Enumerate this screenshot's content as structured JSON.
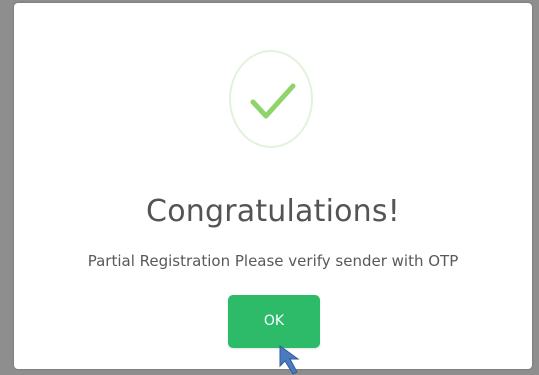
{
  "dialog": {
    "icon": "checkmark-icon",
    "title": "Congratulations!",
    "message": "Partial Registration Please verify sender with OTP",
    "ok_label": "OK"
  },
  "colors": {
    "accent": "#2dbb6a",
    "check_stroke": "#8fd46a",
    "circle_border": "#e3f2dc",
    "title_text": "#545454",
    "cursor": "#4a7bbf"
  },
  "cursor": {
    "icon": "mouse-pointer-icon"
  }
}
